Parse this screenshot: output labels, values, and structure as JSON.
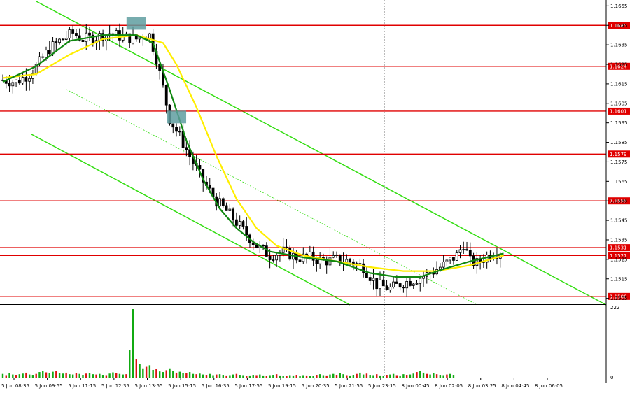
{
  "chart_data": {
    "type": "candlestick",
    "instrument_hint": "EURUSD",
    "price_axis": {
      "ticks": [
        "1.1655",
        "1.1645",
        "1.1635",
        "1.1625",
        "1.1615",
        "1.1605",
        "1.1595",
        "1.1585",
        "1.1575",
        "1.1565",
        "1.1555",
        "1.1545",
        "1.1535",
        "1.1525",
        "1.1515",
        "1.1505"
      ],
      "ylim": [
        1.1502,
        1.1658
      ]
    },
    "volume_axis": {
      "ticks": [
        "222",
        "0"
      ],
      "ylim": [
        0,
        222
      ]
    },
    "time_axis": {
      "labels": [
        "5 Jun 08:35",
        "5 Jun 09:55",
        "5 Jun 11:15",
        "5 Jun 12:35",
        "5 Jun 13:55",
        "5 Jun 15:15",
        "5 Jun 16:35",
        "5 Jun 17:55",
        "5 Jun 19:15",
        "5 Jun 20:35",
        "5 Jun 21:55",
        "5 Jun 23:15",
        "8 Jun 00:45",
        "8 Jun 02:05",
        "8 Jun 03:25",
        "8 Jun 04:45",
        "8 Jun 06:05"
      ]
    },
    "levels": [
      {
        "price": 1.1645,
        "label": "1.1645",
        "color": "#e00000"
      },
      {
        "price": 1.1624,
        "label": "1.1624",
        "color": "#e00000"
      },
      {
        "price": 1.1601,
        "label": "1.1601",
        "color": "#e00000"
      },
      {
        "price": 1.1579,
        "label": "1.1579",
        "color": "#e00000"
      },
      {
        "price": 1.1555,
        "label": "1.1555",
        "color": "#e00000"
      },
      {
        "price": 1.1531,
        "label": "1.1531",
        "color": "#e00000"
      },
      {
        "price": 1.1527,
        "label": "1.1527",
        "color": "#e00000"
      },
      {
        "price": 1.1506,
        "label": "1.1506",
        "color": "#e00000"
      }
    ],
    "price_path": [
      [
        0,
        1.1617
      ],
      [
        4,
        1.1616
      ],
      [
        8,
        1.162
      ],
      [
        11,
        1.1626
      ],
      [
        14,
        1.1633
      ],
      [
        17,
        1.1637
      ],
      [
        21,
        1.1641
      ],
      [
        24,
        1.1638
      ],
      [
        28,
        1.1639
      ],
      [
        32,
        1.1641
      ],
      [
        36,
        1.1639
      ],
      [
        40,
        1.1638
      ],
      [
        42,
        1.164
      ],
      [
        44,
        1.164
      ],
      [
        46,
        1.1628
      ],
      [
        48,
        1.1613
      ],
      [
        50,
        1.1597
      ],
      [
        53,
        1.1588
      ],
      [
        56,
        1.1578
      ],
      [
        60,
        1.1565
      ],
      [
        64,
        1.1555
      ],
      [
        68,
        1.1548
      ],
      [
        72,
        1.154
      ],
      [
        76,
        1.1532
      ],
      [
        80,
        1.1527
      ],
      [
        84,
        1.1529
      ],
      [
        88,
        1.1526
      ],
      [
        92,
        1.1526
      ],
      [
        96,
        1.1524
      ],
      [
        100,
        1.1525
      ],
      [
        104,
        1.1524
      ],
      [
        108,
        1.1521
      ],
      [
        112,
        1.1512
      ],
      [
        116,
        1.151
      ],
      [
        120,
        1.1513
      ],
      [
        124,
        1.1515
      ],
      [
        128,
        1.1518
      ],
      [
        132,
        1.1522
      ],
      [
        136,
        1.1527
      ],
      [
        138,
        1.1533
      ],
      [
        140,
        1.1524
      ],
      [
        142,
        1.1523
      ],
      [
        146,
        1.1528
      ],
      [
        150,
        1.1529
      ]
    ],
    "ma_fast": [
      [
        0,
        1.1616
      ],
      [
        10,
        1.1624
      ],
      [
        20,
        1.1637
      ],
      [
        30,
        1.164
      ],
      [
        40,
        1.164
      ],
      [
        45,
        1.1636
      ],
      [
        50,
        1.1612
      ],
      [
        55,
        1.1586
      ],
      [
        60,
        1.1566
      ],
      [
        65,
        1.1551
      ],
      [
        70,
        1.1541
      ],
      [
        75,
        1.1534
      ],
      [
        80,
        1.1529
      ],
      [
        90,
        1.1526
      ],
      [
        100,
        1.1524
      ],
      [
        110,
        1.1518
      ],
      [
        118,
        1.1516
      ],
      [
        125,
        1.1516
      ],
      [
        132,
        1.152
      ],
      [
        140,
        1.1524
      ],
      [
        150,
        1.1528
      ]
    ],
    "ma_slow": [
      [
        0,
        1.1618
      ],
      [
        10,
        1.162
      ],
      [
        20,
        1.163
      ],
      [
        30,
        1.1638
      ],
      [
        40,
        1.164
      ],
      [
        48,
        1.1636
      ],
      [
        52,
        1.1625
      ],
      [
        58,
        1.1603
      ],
      [
        64,
        1.1578
      ],
      [
        70,
        1.1556
      ],
      [
        76,
        1.1541
      ],
      [
        82,
        1.1532
      ],
      [
        90,
        1.1527
      ],
      [
        100,
        1.1524
      ],
      [
        110,
        1.1521
      ],
      [
        120,
        1.1519
      ],
      [
        130,
        1.1519
      ],
      [
        140,
        1.1522
      ],
      [
        150,
        1.1527
      ]
    ],
    "volumes": [
      12,
      8,
      14,
      10,
      9,
      11,
      13,
      16,
      10,
      9,
      12,
      18,
      22,
      17,
      14,
      19,
      21,
      15,
      13,
      16,
      11,
      10,
      14,
      12,
      9,
      13,
      15,
      11,
      10,
      12,
      9,
      8,
      13,
      17,
      14,
      12,
      10,
      11,
      90,
      222,
      60,
      45,
      30,
      35,
      40,
      25,
      28,
      20,
      18,
      24,
      30,
      22,
      16,
      19,
      15,
      14,
      18,
      12,
      11,
      13,
      10,
      9,
      12,
      8,
      10,
      11,
      9,
      7,
      8,
      10,
      12,
      9,
      8,
      6,
      7,
      9,
      8,
      10,
      7,
      6,
      8,
      9,
      11,
      7,
      6,
      5,
      8,
      7,
      9,
      6,
      8,
      7,
      5,
      6,
      9,
      11,
      8,
      7,
      10,
      12,
      9,
      14,
      11,
      8,
      7,
      9,
      12,
      16,
      10,
      13,
      9,
      8,
      11,
      7,
      6,
      9,
      10,
      12,
      8,
      7,
      11,
      9,
      10,
      13,
      18,
      22,
      16,
      12,
      10,
      14,
      11,
      9,
      8,
      10,
      12,
      9
    ],
    "signals": [
      {
        "bar": 40,
        "price": 1.1646
      },
      {
        "bar": 52,
        "price": 1.1598
      }
    ]
  }
}
